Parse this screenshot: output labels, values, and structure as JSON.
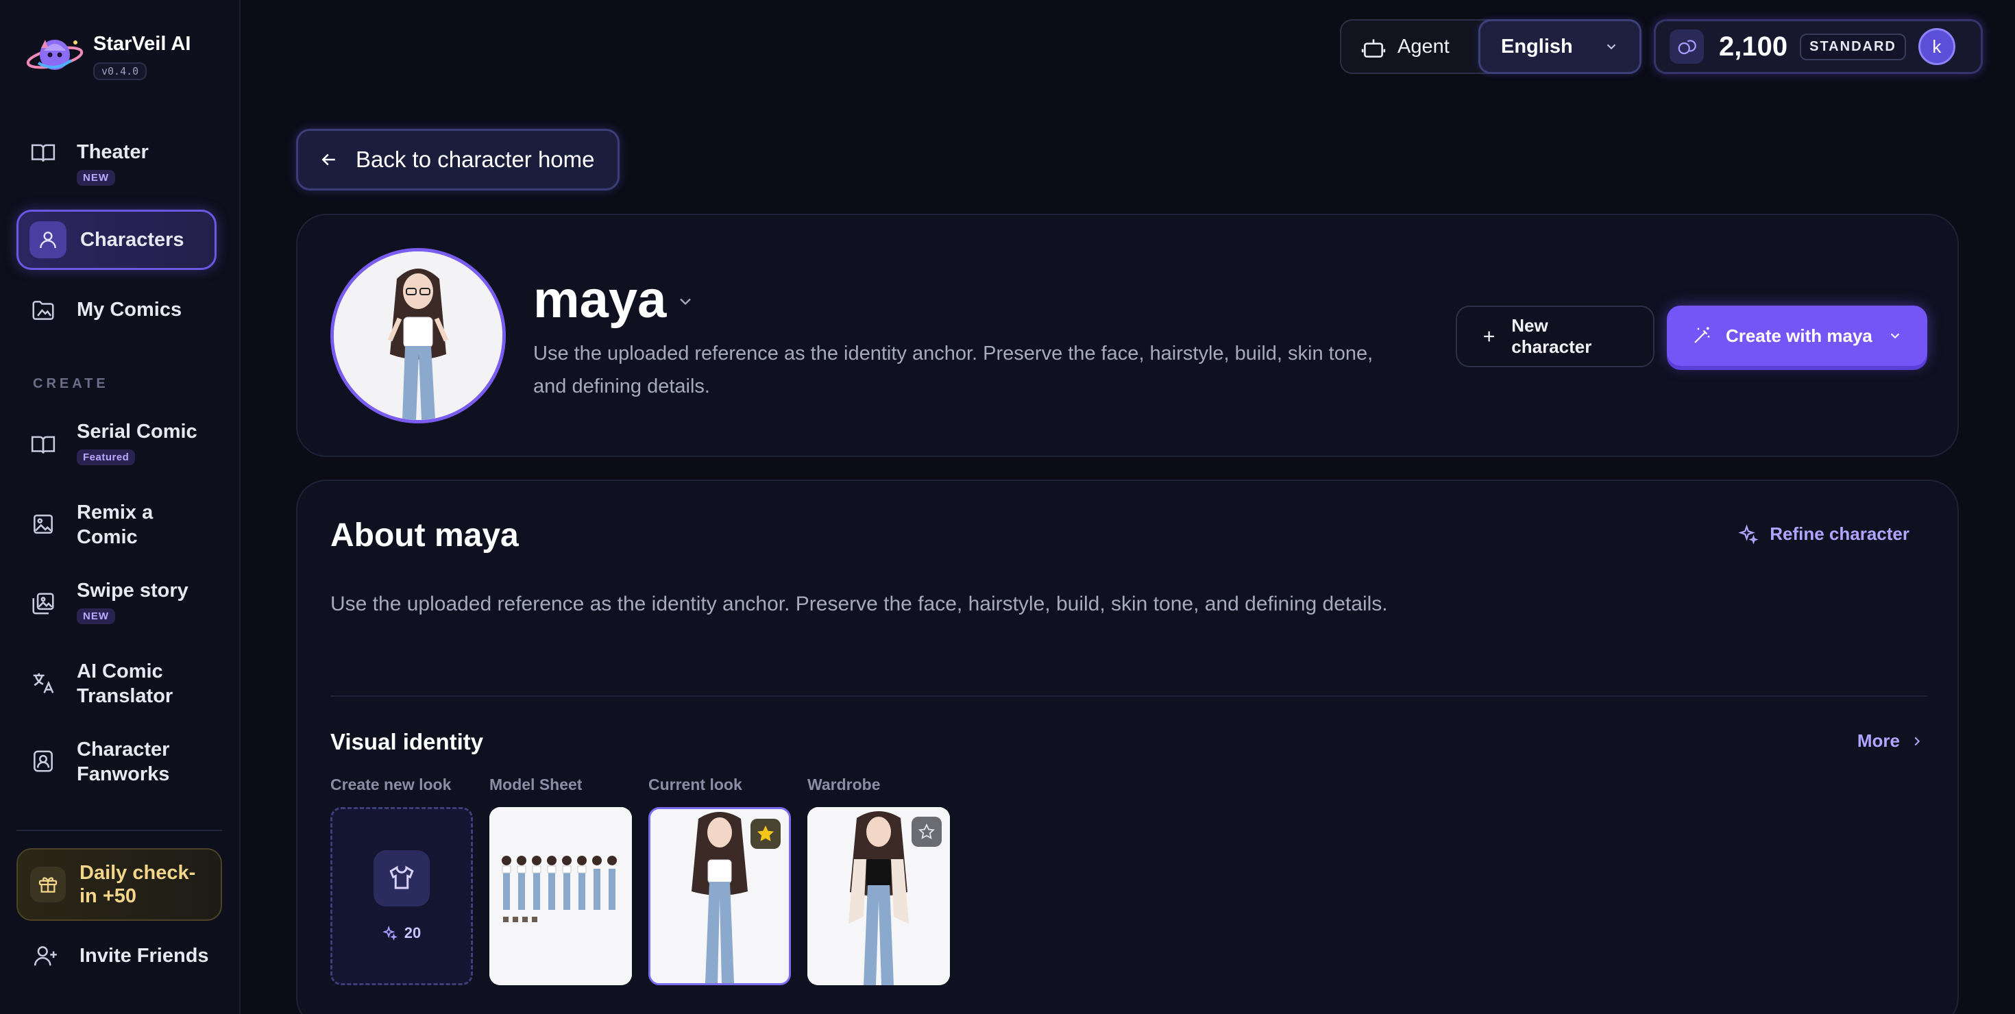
{
  "brand": {
    "name": "StarVeil AI",
    "version": "v0.4.0"
  },
  "sidebar": {
    "items": [
      {
        "label": "Theater",
        "badge": "NEW",
        "icon": "book-open-icon"
      },
      {
        "label": "Characters",
        "icon": "user-icon",
        "active": true
      },
      {
        "label": "My Comics",
        "icon": "folder-image-icon"
      }
    ],
    "section_label": "CREATE",
    "create_items": [
      {
        "label": "Serial Comic",
        "badge": "Featured",
        "icon": "book-open-icon"
      },
      {
        "label": "Remix a Comic",
        "icon": "image-icon"
      },
      {
        "label": "Swipe story",
        "badge": "NEW",
        "icon": "images-icon"
      },
      {
        "label": "AI Comic Translator",
        "icon": "translate-icon"
      },
      {
        "label": "Character Fanworks",
        "icon": "contact-icon"
      }
    ],
    "checkin": "Daily check-in +50",
    "invite": "Invite Friends"
  },
  "topbar": {
    "agent": "Agent",
    "language": "English",
    "credits": "2,100",
    "plan": "STANDARD",
    "avatar_initial": "k"
  },
  "back_button": "Back to character home",
  "character": {
    "name": "maya",
    "description": "Use the uploaded reference as the identity anchor. Preserve the face, hairstyle, build, skin tone, and defining details.",
    "new_character": "New character",
    "create_with": "Create with maya"
  },
  "about": {
    "title": "About maya",
    "refine": "Refine character",
    "description": "Use the uploaded reference as the identity anchor. Preserve the face, hairstyle, build, skin tone, and defining details.",
    "visual_identity": "Visual identity",
    "more": "More",
    "tiles": [
      {
        "label": "Create new look",
        "cost": "20"
      },
      {
        "label": "Model Sheet"
      },
      {
        "label": "Current look",
        "starred": true
      },
      {
        "label": "Wardrobe",
        "starred": false
      }
    ]
  },
  "colors": {
    "accent": "#7455f5",
    "background": "#0b0c16",
    "checkin_text": "#f3d68a",
    "star": "#f5c518"
  }
}
